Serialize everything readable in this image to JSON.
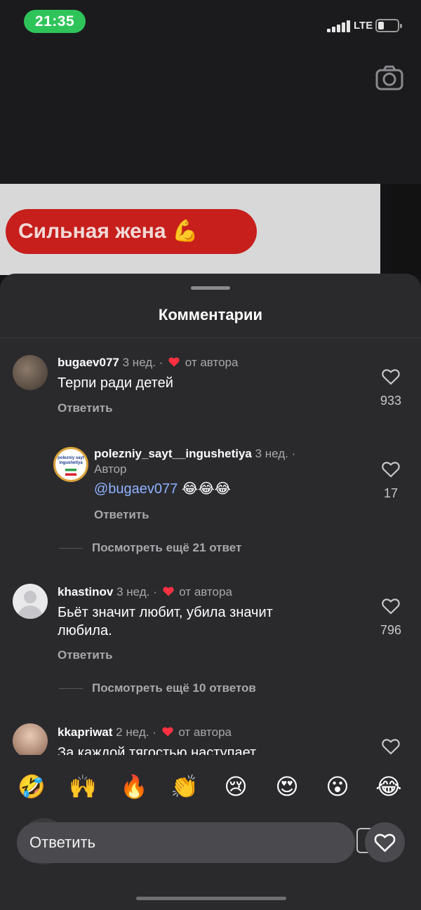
{
  "status_bar": {
    "time": "21:35",
    "network": "LTE",
    "battery_level": 0.2
  },
  "video": {
    "banner_text": "Сильная жена 💪"
  },
  "sheet": {
    "title": "Комментарии"
  },
  "comments": [
    {
      "username": "bugaev077",
      "time": "3 нед.",
      "author_badge": "от автора",
      "text": "Терпи ради детей",
      "reply_label": "Ответить",
      "likes": "933"
    },
    {
      "username": "khastinov",
      "time": "3 нед.",
      "author_badge": "от автора",
      "text": "Бьёт значит любит, убила значит любила.",
      "reply_label": "Ответить",
      "likes": "796",
      "more_replies": "Посмотреть ещё 10 ответов"
    },
    {
      "username": "kkapriwat",
      "time": "2 нед.",
      "author_badge": "от автора",
      "text": "За каждой тягостью наступает"
    }
  ],
  "nested_reply": {
    "username": "polezniy_sayt__ingushetiya",
    "time": "3 нед. ·",
    "role": "Автор",
    "mention": "@bugaev077",
    "emojis": "😂😂😂",
    "reply_label": "Ответить",
    "likes": "17",
    "avatar_text": "polezniy sayt ingushetiya"
  },
  "more_replies_1": "Посмотреть ещё 21 ответ",
  "emoji_bar": [
    "🤣",
    "🙌",
    "🔥",
    "👏",
    "😢",
    "😍",
    "😮",
    "😂"
  ],
  "composer": {
    "placeholder": "Ответить"
  },
  "colors": {
    "accent_link": "#8fb2ff",
    "heart_red": "#ff3040",
    "sheet_bg": "#2a2a2d"
  }
}
